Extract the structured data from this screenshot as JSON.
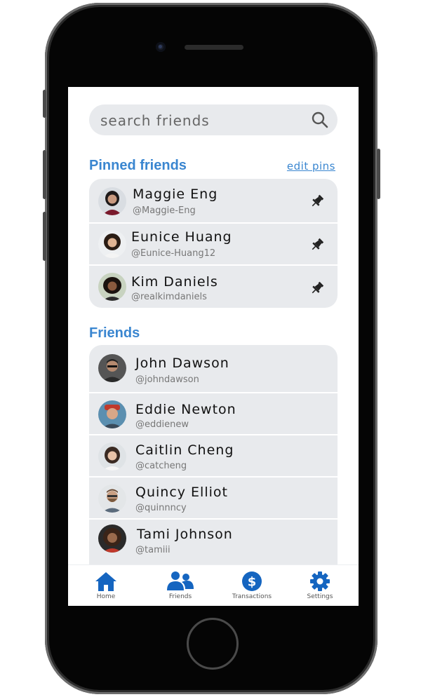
{
  "search": {
    "placeholder": "search friends"
  },
  "pinned": {
    "title": "Pinned friends",
    "edit_label": "edit pins",
    "items": [
      {
        "name": "Maggie Eng",
        "handle": "@Maggie-Eng"
      },
      {
        "name": "Eunice Huang",
        "handle": "@Eunice-Huang12"
      },
      {
        "name": "Kim Daniels",
        "handle": "@realkimdaniels"
      }
    ]
  },
  "friends": {
    "title": "Friends",
    "items": [
      {
        "name": "John Dawson",
        "handle": "@johndawson"
      },
      {
        "name": "Eddie Newton",
        "handle": "@eddienew"
      },
      {
        "name": "Caitlin Cheng",
        "handle": "@catcheng"
      },
      {
        "name": "Quincy Elliot",
        "handle": "@quinnncy"
      },
      {
        "name": "Tami Johnson",
        "handle": "@tamiii"
      }
    ]
  },
  "tabs": [
    {
      "label": "Home",
      "icon": "home-icon"
    },
    {
      "label": "Friends",
      "icon": "friends-icon"
    },
    {
      "label": "Transactions",
      "icon": "dollar-icon"
    },
    {
      "label": "Settings",
      "icon": "gear-icon"
    }
  ],
  "colors": {
    "accent": "#3a86d0",
    "tab_icon": "#1565c0",
    "card_bg": "#e8eaed"
  }
}
